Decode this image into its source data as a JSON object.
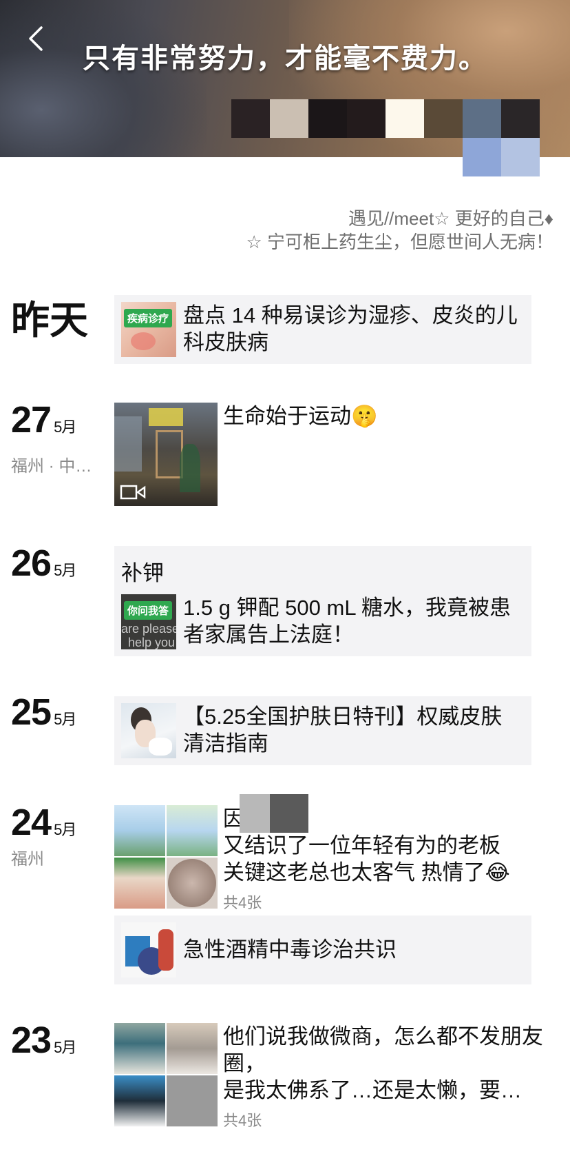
{
  "cover": {
    "slogan": "只有非常努力，才能毫不费力。"
  },
  "signature": {
    "line1": "遇见//meet☆ 更好的自己♦",
    "line2": "☆ 宁可柜上药生尘，但愿世间人无病！"
  },
  "timeline": {
    "yesterday": {
      "label": "昨天",
      "share_title": "盘点 14 种易误诊为湿疹、皮炎的儿科皮肤病",
      "thumb_tag": "疾病诊疗"
    },
    "d27": {
      "day": "27",
      "month": "5月",
      "location": "福州 · 中…",
      "text": "生命始于运动🤫"
    },
    "d26": {
      "day": "26",
      "month": "5月",
      "text": "补钾",
      "share_title": "1.5 g 钾配 500 mL 糖水，我竟被患者家属告上法庭！",
      "thumb_tag": "你问我答",
      "thumb_sub1": "are please",
      "thumb_sub2": "help you"
    },
    "d25": {
      "day": "25",
      "month": "5月",
      "share_title": "【5.25全国护肤日特刊】权威皮肤清洁指南"
    },
    "d24": {
      "day": "24",
      "month": "5月",
      "location": "福州",
      "text_line1": "因",
      "text_line2": "又结识了一位年轻有为的老板",
      "text_line3": "关键这老总也太客气 热情了😂",
      "count": "共4张",
      "share_title": "急性酒精中毒诊治共识"
    },
    "d23": {
      "day": "23",
      "month": "5月",
      "text": "他们说我做微商，怎么都不发朋友圈，\n是我太佛系了…还是太懒，要…",
      "count": "共4张"
    }
  },
  "colors": {
    "card_bg": "#f3f3f5",
    "meta_gray": "#8a8a8a",
    "tag_green": "#2fa84f"
  }
}
